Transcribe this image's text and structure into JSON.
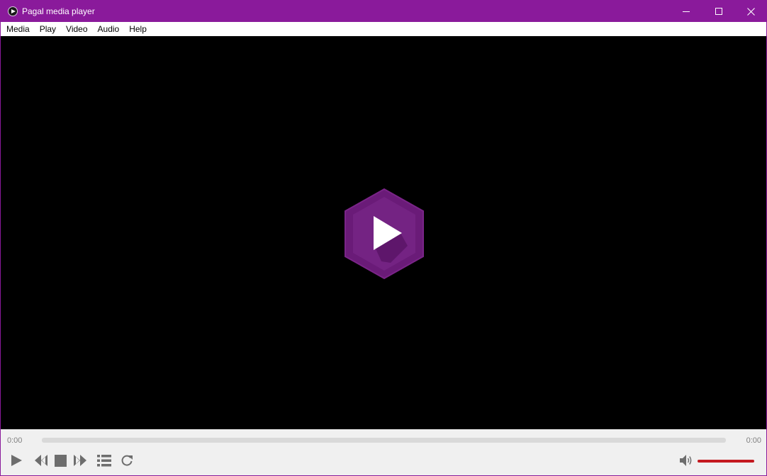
{
  "window": {
    "title": "Pagal media player",
    "buttons": {
      "minimize": "minimize",
      "maximize": "maximize",
      "close": "close"
    }
  },
  "colors": {
    "accent": "#8a1a9b",
    "volume": "#c4191f",
    "seek_track": "#d9d9d9",
    "video_bg": "#000000",
    "play_hexagon": "#6a1b78"
  },
  "menu": {
    "items": [
      "Media",
      "Play",
      "Video",
      "Audio",
      "Help"
    ]
  },
  "video": {
    "center_icon": "play-hexagon-icon"
  },
  "playback": {
    "elapsed": "0:00",
    "duration": "0:00",
    "progress": 0
  },
  "controls": {
    "icons": [
      "play-icon",
      "previous-icon",
      "stop-icon",
      "next-icon",
      "playlist-icon",
      "repeat-icon",
      "volume-icon"
    ]
  },
  "volume": {
    "level": 1.0
  }
}
